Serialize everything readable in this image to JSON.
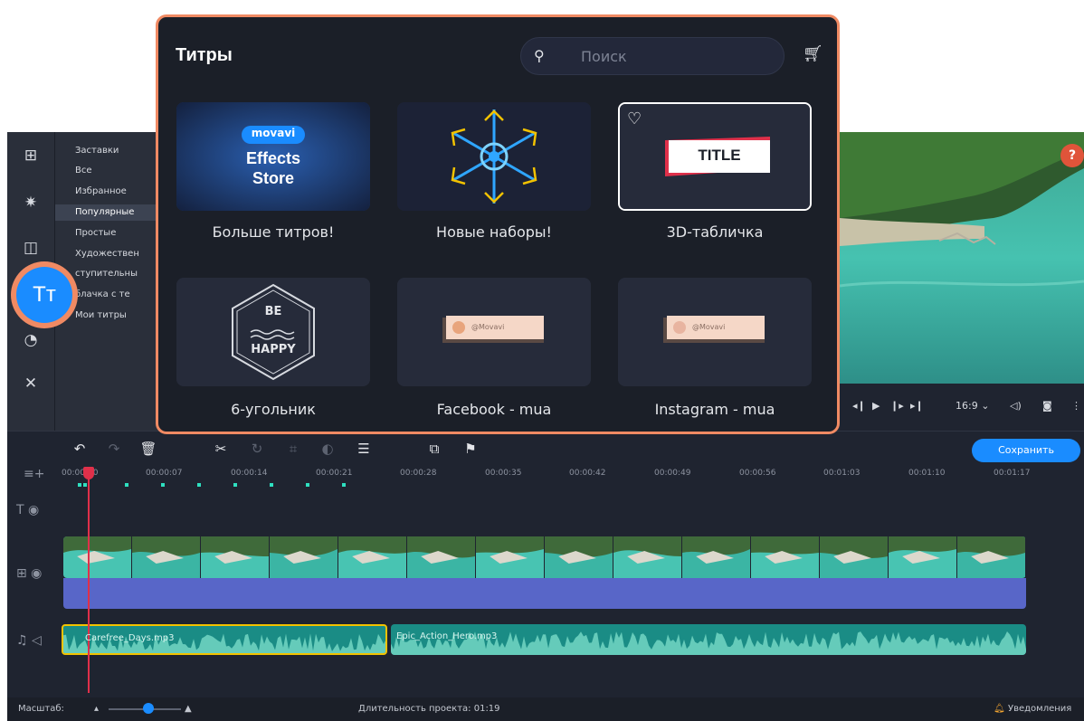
{
  "popup": {
    "title": "Титры",
    "search_placeholder": "Поиск",
    "tiles": [
      {
        "label": "Больше титров!",
        "badge": "movavi",
        "line1": "Effects",
        "line2": "Store"
      },
      {
        "label": "Новые наборы!"
      },
      {
        "label": "3D-табличка",
        "sample_text": "TITLE"
      },
      {
        "label": "6-угольник",
        "line1": "BE",
        "line2": "HAPPY"
      },
      {
        "label": "Facebook - mua",
        "sample_text": "@Movavi"
      },
      {
        "label": "Instagram - mua",
        "sample_text": "@Movavi"
      }
    ]
  },
  "categories": [
    "Заставки",
    "Все",
    "Избранное",
    "Популярные",
    "Простые",
    "Художествен",
    "ступительны",
    "блачка с те",
    "Мои титры"
  ],
  "active_category_index": 3,
  "player": {
    "aspect": "16:9 ⌄"
  },
  "toolbar": {
    "save_label": "Сохранить"
  },
  "ruler": {
    "ticks": [
      "00:00:00",
      "00:00:07",
      "00:00:14",
      "00:00:21",
      "00:00:28",
      "00:00:35",
      "00:00:42",
      "00:00:49",
      "00:00:56",
      "00:01:03",
      "00:01:10",
      "00:01:17"
    ]
  },
  "audio": {
    "clip1": "Carefree_Days.mp3",
    "clip2": "Epic_Action_Hero.mp3"
  },
  "status": {
    "scale_label": "Масштаб:",
    "duration": "Длительность проекта: 01:19",
    "notifications": "Уведомления"
  },
  "help": "?",
  "titles_icon": "Tт",
  "colors": {
    "accent": "#1a8cff",
    "highlight": "#f08a63",
    "audio": "#1a8c85",
    "video_band": "#5866c8"
  }
}
